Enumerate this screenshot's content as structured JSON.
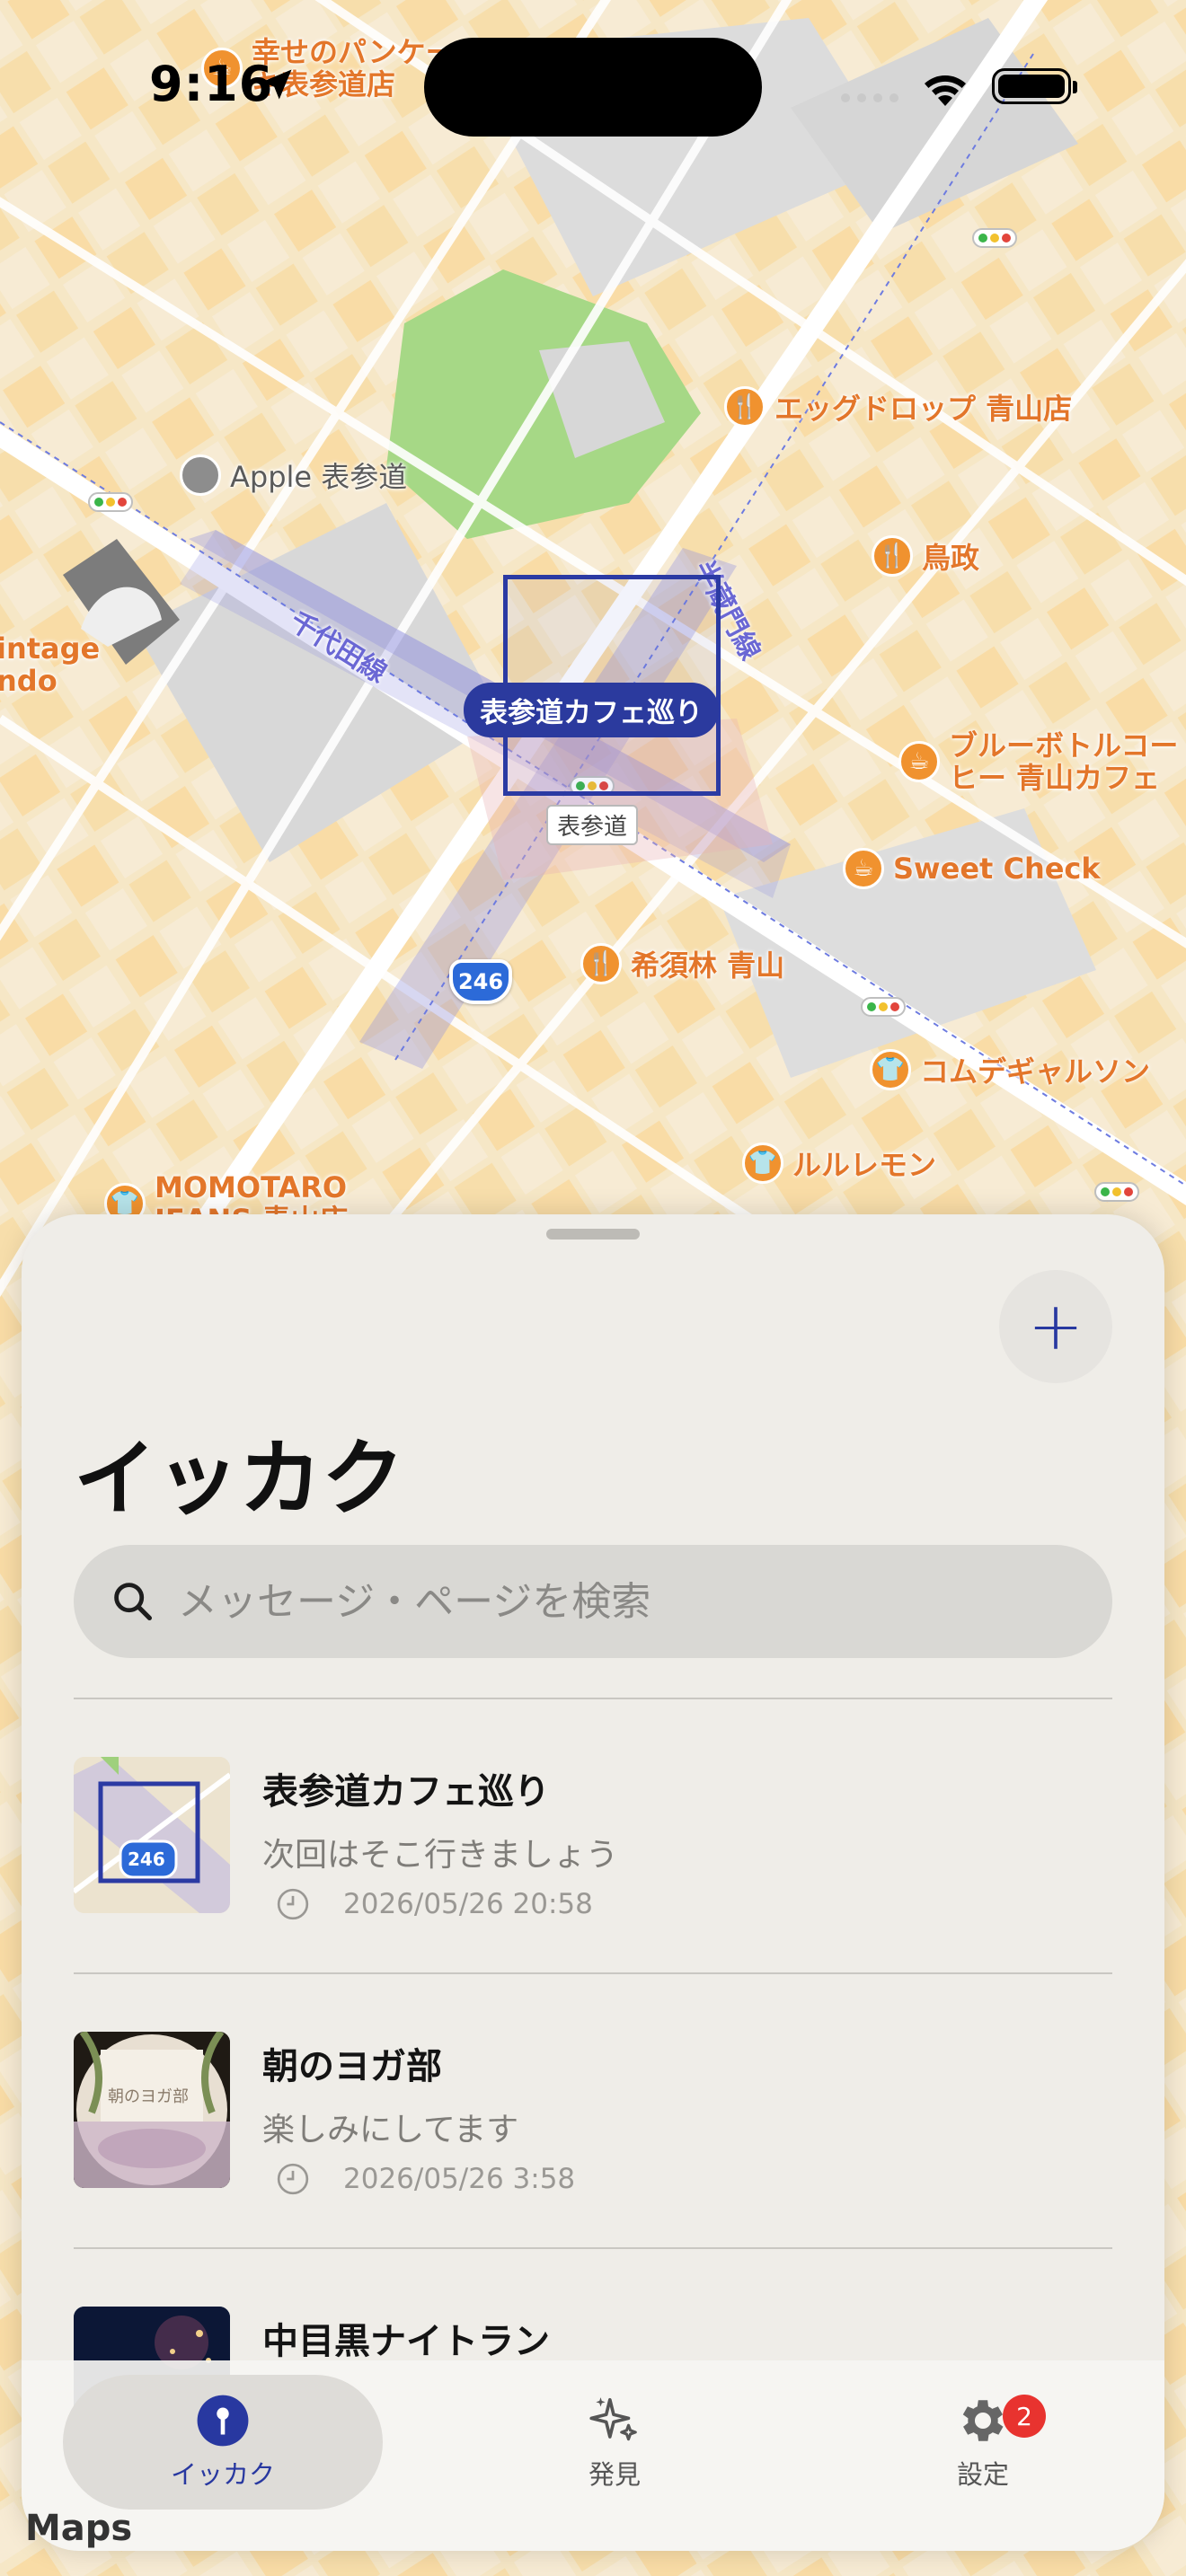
{
  "status_bar": {
    "time": "9:16"
  },
  "map": {
    "pois": [
      {
        "label": "幸せのパンケーキ表参道店",
        "line1": "幸せのパンケー",
        "line2": "キ表参道店",
        "icon": "cafe-icon"
      },
      {
        "label": "Apple 表参道",
        "icon": "apple-logo-icon"
      },
      {
        "label": "エッグドロップ 青山店",
        "icon": "restaurant-icon"
      },
      {
        "label": "鳥政",
        "icon": "restaurant-icon"
      },
      {
        "label": "ブルーボトルコーヒー 青山カフェ",
        "line1": "ブルーボトルコー",
        "line2": "ヒー 青山カフェ",
        "icon": "cafe-icon"
      },
      {
        "label": "Sweet Check",
        "icon": "cafe-icon"
      },
      {
        "label": "希須林 青山",
        "icon": "restaurant-icon"
      },
      {
        "label": "コムデギャルソン",
        "icon": "clothing-icon"
      },
      {
        "label": "ルルレモン",
        "icon": "clothing-icon"
      },
      {
        "label": "MOMOTARO JEANS 青山店",
        "line1": "MOMOTARO",
        "line2": "JEANS 青山店",
        "icon": "clothing-icon"
      },
      {
        "label": "Vintage ando",
        "line1": "intage",
        "line2": "ndo",
        "icon": "shop-icon"
      }
    ],
    "rail_lines": {
      "chiyoda": "千代田線",
      "hanzomon": "半蔵門線"
    },
    "station": "表参道",
    "route_number": "246",
    "selected_area_label": "表参道カフェ巡り",
    "attribution": "Maps"
  },
  "sheet": {
    "title": "イッカク",
    "search_placeholder": "メッセージ・ページを検索",
    "items": [
      {
        "title": "表参道カフェ巡り",
        "message": "次回はそこ行きましょう",
        "timestamp": "2026/05/26 20:58",
        "thumb": "map",
        "thumb_text": "246"
      },
      {
        "title": "朝のヨガ部",
        "message": "楽しみにしてます",
        "timestamp": "2026/05/26 3:58",
        "thumb": "yoga",
        "thumb_text": "朝のヨガ部"
      },
      {
        "title": "中目黒ナイトラン",
        "message": "",
        "timestamp": "",
        "thumb": "night"
      }
    ]
  },
  "tabbar": {
    "tabs": [
      {
        "label": "イッカク",
        "icon": "pin-icon",
        "active": true
      },
      {
        "label": "発見",
        "icon": "sparkles-icon",
        "active": false
      },
      {
        "label": "設定",
        "icon": "gear-icon",
        "active": false,
        "badge": "2"
      }
    ]
  },
  "colors": {
    "accent": "#2838a0",
    "badge": "#e8332f",
    "poi_orange": "#f0922f"
  }
}
